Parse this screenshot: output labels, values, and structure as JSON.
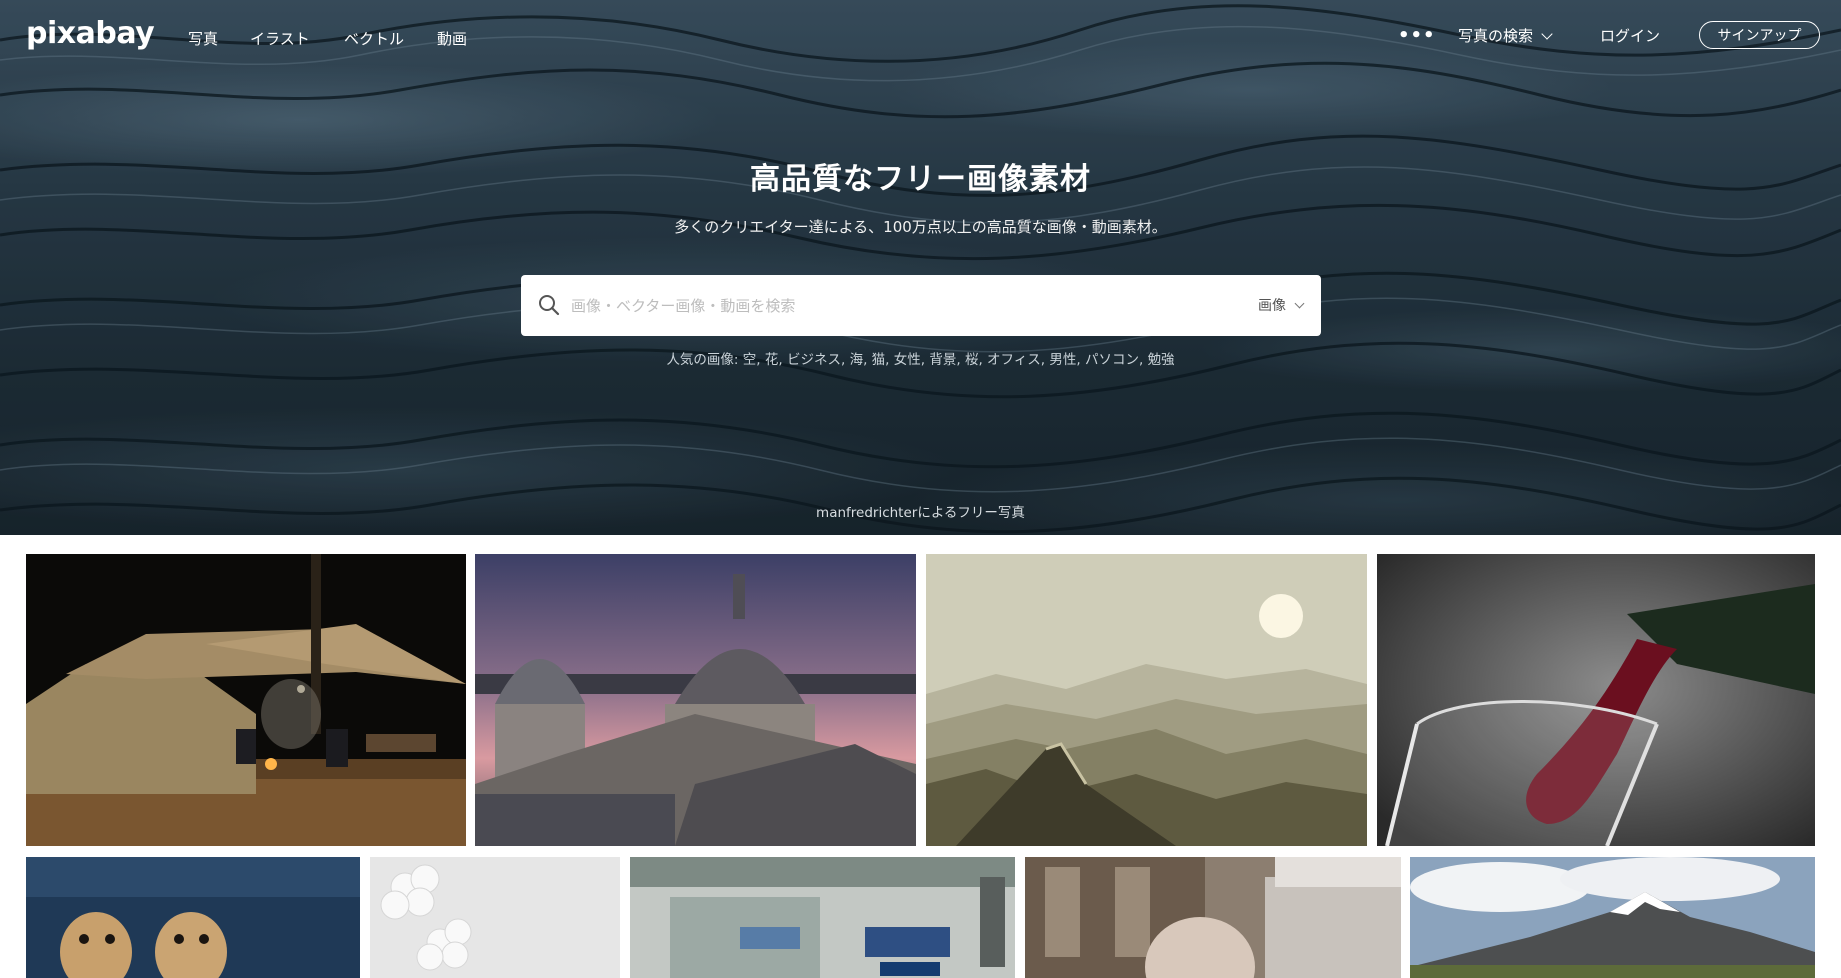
{
  "nav": {
    "logo": "pixabay",
    "links": [
      "写真",
      "イラスト",
      "ベクトル",
      "動画"
    ],
    "more": "•••",
    "search_dropdown": "写真の検索",
    "login": "ログイン",
    "signup": "サインアップ"
  },
  "hero": {
    "title": "高品質なフリー画像素材",
    "subtitle": "多くのクリエイター達による、100万点以上の高品質な画像・動画素材。",
    "search_placeholder": "画像・ベクター画像・動画を検索",
    "search_type": "画像",
    "popular_label": "人気の画像:",
    "popular_tags": [
      "空",
      "花",
      "ビジネス",
      "海",
      "猫",
      "女性",
      "背景",
      "桜",
      "オフィス",
      "男性",
      "パソコン",
      "勉強"
    ],
    "credit": "manfredrichterによるフリー写真"
  },
  "gallery": {
    "row1": [
      {
        "subject": "camping-tent-night"
      },
      {
        "subject": "pisa-cathedral-dusk"
      },
      {
        "subject": "great-wall-mountains"
      },
      {
        "subject": "red-wine-pour"
      }
    ],
    "row2": [
      {
        "subject": "meerkats"
      },
      {
        "subject": "white-paper-flowers"
      },
      {
        "subject": "train-station"
      },
      {
        "subject": "elderly-man-street"
      },
      {
        "subject": "snowy-mountain"
      }
    ]
  }
}
